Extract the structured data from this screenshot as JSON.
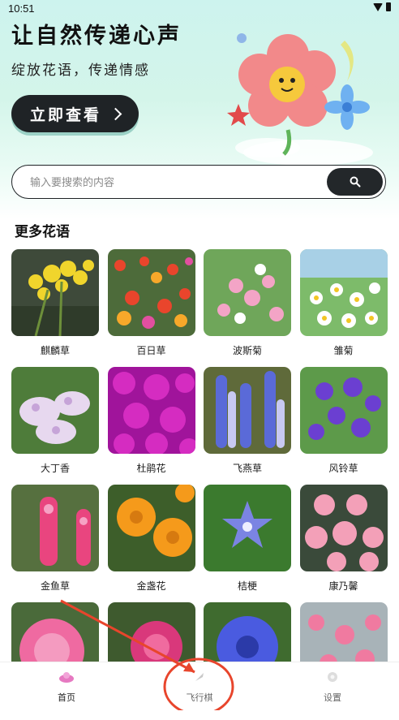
{
  "status_bar": {
    "time": "10:51"
  },
  "hero": {
    "title": "让自然传递心声",
    "subtitle": "绽放花语，传递情感",
    "cta_label": "立即查看"
  },
  "search": {
    "placeholder": "输入要搜索的内容",
    "value": ""
  },
  "section": {
    "title": "更多花语"
  },
  "flowers": [
    {
      "name": "麒麟草"
    },
    {
      "name": "百日草"
    },
    {
      "name": "波斯菊"
    },
    {
      "name": "雏菊"
    },
    {
      "name": "大丁香"
    },
    {
      "name": "杜鹃花"
    },
    {
      "name": "飞燕草"
    },
    {
      "name": "风铃草"
    },
    {
      "name": "金鱼草"
    },
    {
      "name": "金盏花"
    },
    {
      "name": "桔梗"
    },
    {
      "name": "康乃馨"
    },
    {
      "name": ""
    },
    {
      "name": ""
    },
    {
      "name": ""
    },
    {
      "name": ""
    }
  ],
  "tabbar": {
    "tabs": [
      {
        "label": "首页",
        "icon": "home-flower-icon",
        "active": true
      },
      {
        "label": "飞行棋",
        "icon": "flight-chess-icon",
        "active": false
      },
      {
        "label": "设置",
        "icon": "settings-icon",
        "active": false
      }
    ]
  },
  "colors": {
    "accent": "#1f2326",
    "annotation": "#e8452c",
    "hero_bg": "#cdf3ee"
  }
}
